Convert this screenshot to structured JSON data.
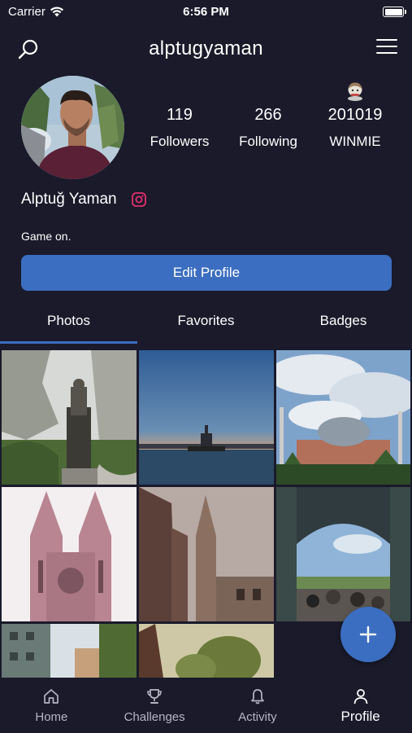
{
  "status_bar": {
    "carrier": "Carrier",
    "time": "6:56 PM",
    "battery_level": 1.0
  },
  "nav": {
    "title": "alptugyaman",
    "search_icon": "search-icon",
    "menu_icon": "hamburger-menu-icon"
  },
  "profile": {
    "name": "Alptuğ Yaman",
    "bio": "Game on.",
    "edit_label": "Edit Profile",
    "stats": [
      {
        "value": "119",
        "label": "Followers"
      },
      {
        "value": "266",
        "label": "Following"
      },
      {
        "value": "201019",
        "label": "WINMIE",
        "icon": "character-badge-icon"
      }
    ]
  },
  "tabs": [
    {
      "label": "Photos",
      "active": true
    },
    {
      "label": "Favorites",
      "active": false
    },
    {
      "label": "Badges",
      "active": false
    }
  ],
  "bottom_nav": [
    {
      "label": "Home",
      "icon": "home-icon",
      "active": false
    },
    {
      "label": "Challenges",
      "icon": "trophy-icon",
      "active": false
    },
    {
      "label": "Activity",
      "icon": "bell-icon",
      "active": false
    },
    {
      "label": "Profile",
      "icon": "user-icon",
      "active": true
    }
  ],
  "colors": {
    "background": "#1a1a2b",
    "accent": "#3b6ec0",
    "instagram": "#e1306c"
  }
}
